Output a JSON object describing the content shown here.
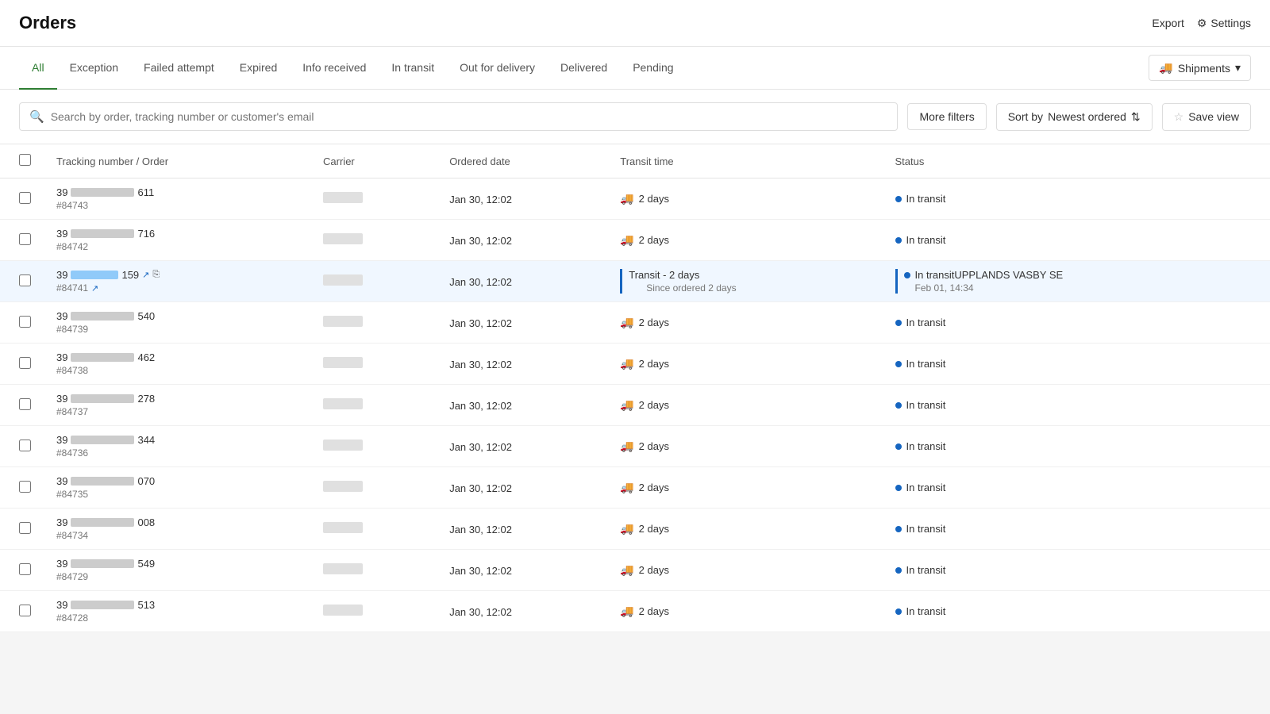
{
  "header": {
    "title": "Orders",
    "export_label": "Export",
    "settings_label": "Settings"
  },
  "tabs": {
    "items": [
      {
        "id": "all",
        "label": "All",
        "active": true
      },
      {
        "id": "exception",
        "label": "Exception",
        "active": false
      },
      {
        "id": "failed_attempt",
        "label": "Failed attempt",
        "active": false
      },
      {
        "id": "expired",
        "label": "Expired",
        "active": false
      },
      {
        "id": "info_received",
        "label": "Info received",
        "active": false
      },
      {
        "id": "in_transit",
        "label": "In transit",
        "active": false
      },
      {
        "id": "out_for_delivery",
        "label": "Out for delivery",
        "active": false
      },
      {
        "id": "delivered",
        "label": "Delivered",
        "active": false
      },
      {
        "id": "pending",
        "label": "Pending",
        "active": false
      }
    ],
    "shipments_label": "Shipments"
  },
  "filters": {
    "search_placeholder": "Search by order, tracking number or customer's email",
    "more_filters_label": "More filters",
    "sort_label": "Sort by",
    "sort_value": "Newest ordered",
    "save_view_label": "Save view"
  },
  "table": {
    "columns": [
      {
        "id": "checkbox",
        "label": ""
      },
      {
        "id": "tracking",
        "label": "Tracking number / Order"
      },
      {
        "id": "carrier",
        "label": "Carrier"
      },
      {
        "id": "ordered_date",
        "label": "Ordered date"
      },
      {
        "id": "transit_time",
        "label": "Transit time"
      },
      {
        "id": "status",
        "label": "Status"
      }
    ],
    "rows": [
      {
        "id": 1,
        "tracking_prefix": "39",
        "tracking_suffix": "611",
        "order": "#84743",
        "carrier": "",
        "ordered_date": "Jan 30, 12:02",
        "transit_days": "2 days",
        "status": "In transit",
        "highlighted": false
      },
      {
        "id": 2,
        "tracking_prefix": "39",
        "tracking_suffix": "716",
        "order": "#84742",
        "carrier": "",
        "ordered_date": "Jan 30, 12:02",
        "transit_days": "2 days",
        "status": "In transit",
        "highlighted": false
      },
      {
        "id": 3,
        "tracking_prefix": "39",
        "tracking_suffix": "159",
        "order": "#84741",
        "carrier": "",
        "ordered_date": "Jan 30, 12:02",
        "transit_days": "Transit - 2 days",
        "transit_detail": "Since ordered 2 days",
        "status": "In transit",
        "status_detail": "UPPLANDS VASBY SE",
        "status_date": "Feb 01, 14:34",
        "highlighted": true
      },
      {
        "id": 4,
        "tracking_prefix": "39",
        "tracking_suffix": "540",
        "order": "#84739",
        "carrier": "",
        "ordered_date": "Jan 30, 12:02",
        "transit_days": "2 days",
        "status": "In transit",
        "highlighted": false
      },
      {
        "id": 5,
        "tracking_prefix": "39",
        "tracking_suffix": "462",
        "order": "#84738",
        "carrier": "",
        "ordered_date": "Jan 30, 12:02",
        "transit_days": "2 days",
        "status": "In transit",
        "highlighted": false
      },
      {
        "id": 6,
        "tracking_prefix": "39",
        "tracking_suffix": "278",
        "order": "#84737",
        "carrier": "",
        "ordered_date": "Jan 30, 12:02",
        "transit_days": "2 days",
        "status": "In transit",
        "highlighted": false
      },
      {
        "id": 7,
        "tracking_prefix": "39",
        "tracking_suffix": "344",
        "order": "#84736",
        "carrier": "",
        "ordered_date": "Jan 30, 12:02",
        "transit_days": "2 days",
        "status": "In transit",
        "highlighted": false
      },
      {
        "id": 8,
        "tracking_prefix": "39",
        "tracking_suffix": "070",
        "order": "#84735",
        "carrier": "",
        "ordered_date": "Jan 30, 12:02",
        "transit_days": "2 days",
        "status": "In transit",
        "highlighted": false
      },
      {
        "id": 9,
        "tracking_prefix": "39",
        "tracking_suffix": "008",
        "order": "#84734",
        "carrier": "",
        "ordered_date": "Jan 30, 12:02",
        "transit_days": "2 days",
        "status": "In transit",
        "highlighted": false
      },
      {
        "id": 10,
        "tracking_prefix": "39",
        "tracking_suffix": "549",
        "order": "#84729",
        "carrier": "",
        "ordered_date": "Jan 30, 12:02",
        "transit_days": "2 days",
        "status": "In transit",
        "highlighted": false
      },
      {
        "id": 11,
        "tracking_prefix": "39",
        "tracking_suffix": "513",
        "order": "#84728",
        "carrier": "",
        "ordered_date": "Jan 30, 12:02",
        "transit_days": "2 days",
        "status": "In transit",
        "highlighted": false
      }
    ]
  }
}
